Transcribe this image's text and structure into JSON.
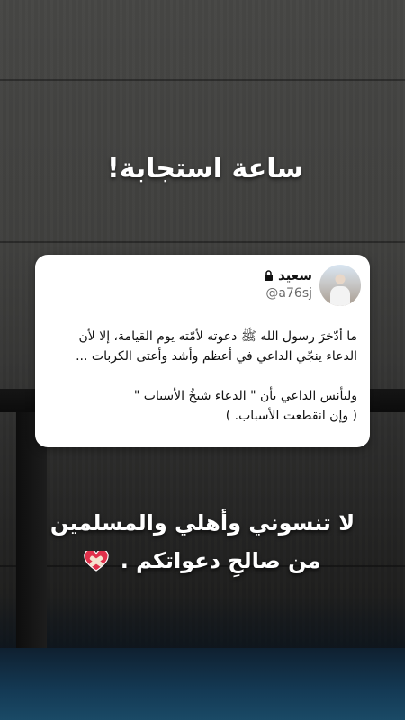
{
  "story": {
    "headline": "ساعة استجابة",
    "headline_mark": "!",
    "caption_line1": "لا تنسوني وأهلي والمسلمين",
    "caption_line2": "من صالحِ دعواتكم ."
  },
  "tweet": {
    "author_name": "سعيد",
    "handle": "@a76sj",
    "paragraph1": "ما أدّخرَ رسول الله ﷺ دعوته لأمّته يوم القيامة، إلا لأن الدعاء ينجّي الداعي في أعظم وأشد وأعتى الكربات ...",
    "paragraph2_line1": "وليأنس الداعي بأن \" الدعاء شيخُ الأسباب \"",
    "paragraph2_line2": "( وإن انقطعت الأسباب. )"
  },
  "icons": {
    "lock": "lock-icon",
    "avatar": "avatar",
    "heart": "mending-heart-icon"
  },
  "colors": {
    "card_bg": "#ffffff",
    "text_white": "#ffffff",
    "heart_red": "#e0314b"
  }
}
